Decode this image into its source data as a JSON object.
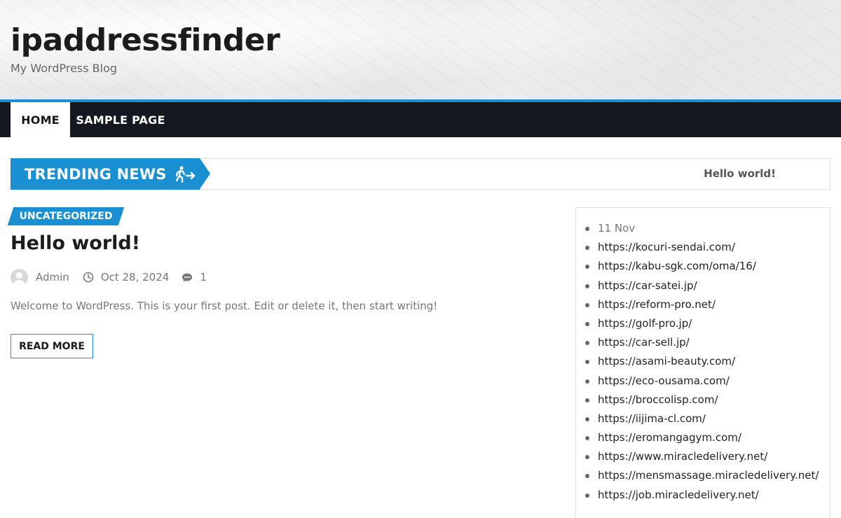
{
  "site": {
    "title": "ipaddressfinder",
    "tagline": "My WordPress Blog"
  },
  "nav": {
    "items": [
      {
        "label": "HOME",
        "active": true
      },
      {
        "label": "SAMPLE PAGE",
        "active": false
      }
    ]
  },
  "trending": {
    "label": "TRENDING NEWS",
    "icon": "running-person-arrow-icon",
    "headline": "Hello world!"
  },
  "post": {
    "category": "UNCATEGORIZED",
    "title": "Hello world!",
    "author": "Admin",
    "date": "Oct 28, 2024",
    "comments": "1",
    "excerpt": "Welcome to WordPress. This is your first post. Edit or delete it, then start writing!",
    "read_more": "READ MORE"
  },
  "sidebar": {
    "date": "11 Nov",
    "links": [
      "https://kocuri-sendai.com/",
      "https://kabu-sgk.com/oma/16/",
      "https://car-satei.jp/",
      "https://reform-pro.net/",
      "https://golf-pro.jp/",
      "https://car-sell.jp/",
      "https://asami-beauty.com/",
      "https://eco-ousama.com/",
      "https://broccolisp.com/",
      "https://iijima-cl.com/",
      "https://eromangagym.com/",
      "https://www.miracledelivery.net/",
      "https://mensmassage.miracledelivery.net/",
      "https://job.miracledelivery.net/"
    ]
  },
  "colors": {
    "accent": "#1a8fd1",
    "nav_bg": "#151820",
    "text_dark": "#1c1c1c",
    "text_muted": "#777777"
  }
}
